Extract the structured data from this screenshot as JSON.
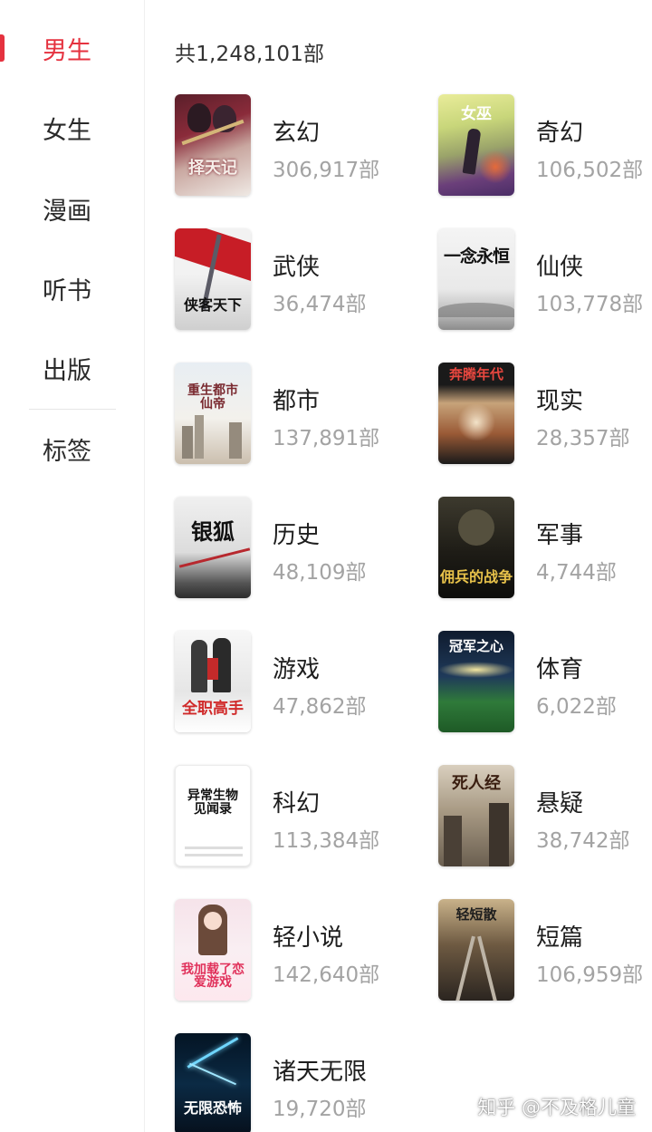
{
  "sidebar": {
    "items": [
      {
        "label": "男生",
        "active": true
      },
      {
        "label": "女生",
        "active": false
      },
      {
        "label": "漫画",
        "active": false
      },
      {
        "label": "听书",
        "active": false
      },
      {
        "label": "出版",
        "active": false
      },
      {
        "label": "标签",
        "active": false
      }
    ],
    "accent_color": "#e5323f"
  },
  "main": {
    "total_label": "共1,248,101部",
    "categories": [
      {
        "name": "玄幻",
        "count": "306,917部",
        "cover_title": "择天记"
      },
      {
        "name": "奇幻",
        "count": "106,502部",
        "cover_title": "女巫"
      },
      {
        "name": "武侠",
        "count": "36,474部",
        "cover_title": "侠客天下"
      },
      {
        "name": "仙侠",
        "count": "103,778部",
        "cover_title": "一念永恒"
      },
      {
        "name": "都市",
        "count": "137,891部",
        "cover_title": "重生都市仙帝"
      },
      {
        "name": "现实",
        "count": "28,357部",
        "cover_title": "奔腾年代"
      },
      {
        "name": "历史",
        "count": "48,109部",
        "cover_title": "银狐"
      },
      {
        "name": "军事",
        "count": "4,744部",
        "cover_title": "佣兵的战争"
      },
      {
        "name": "游戏",
        "count": "47,862部",
        "cover_title": "全职高手"
      },
      {
        "name": "体育",
        "count": "6,022部",
        "cover_title": "冠军之心"
      },
      {
        "name": "科幻",
        "count": "113,384部",
        "cover_title": "异常生物见闻录"
      },
      {
        "name": "悬疑",
        "count": "38,742部",
        "cover_title": "死人经"
      },
      {
        "name": "轻小说",
        "count": "142,640部",
        "cover_title": "我加载了恋爱游戏"
      },
      {
        "name": "短篇",
        "count": "106,959部",
        "cover_title": "轻短散"
      },
      {
        "name": "诸天无限",
        "count": "19,720部",
        "cover_title": "无限恐怖"
      }
    ]
  },
  "watermark": "知乎 @不及格儿童"
}
